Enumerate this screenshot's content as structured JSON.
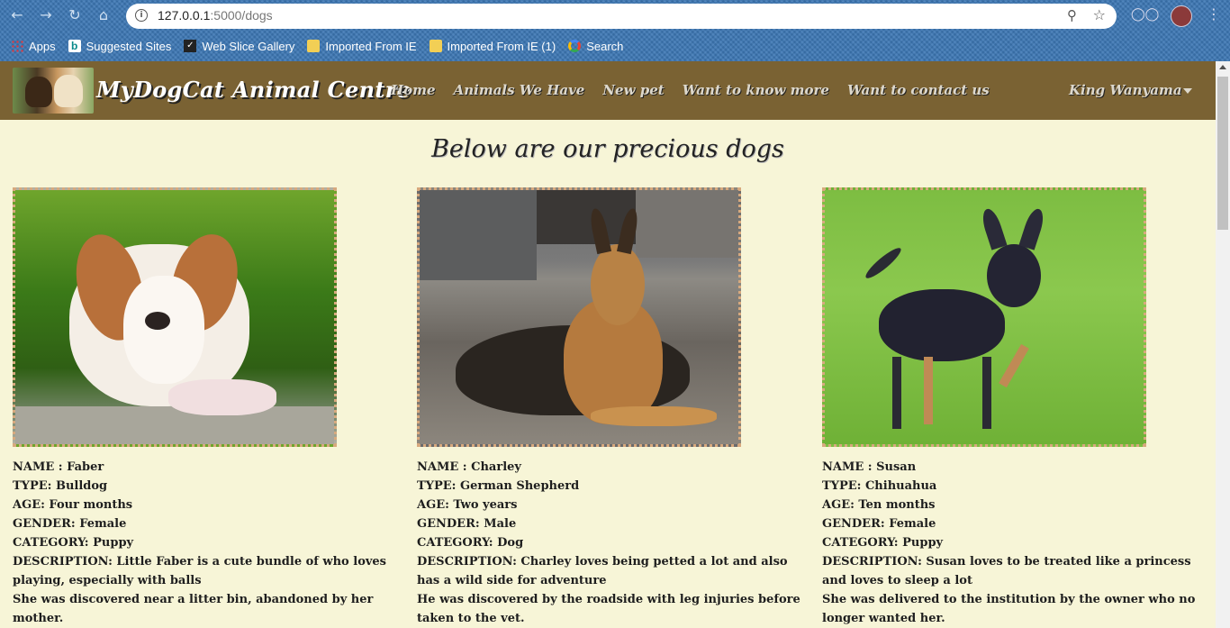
{
  "browser": {
    "url_host": "127.0.0.1",
    "url_path": ":5000/dogs",
    "bookmarks": [
      {
        "label": "Apps",
        "icon": "apps-grid-icon"
      },
      {
        "label": "Suggested Sites",
        "icon": "bing-icon"
      },
      {
        "label": "Web Slice Gallery",
        "icon": "web-slice-icon"
      },
      {
        "label": "Imported From IE",
        "icon": "folder-icon"
      },
      {
        "label": "Imported From IE (1)",
        "icon": "folder-icon"
      },
      {
        "label": "Search",
        "icon": "google-icon"
      }
    ]
  },
  "site": {
    "brand": "MyDogCat Animal Centre",
    "nav": [
      "Home",
      "Animals We Have",
      "New pet",
      "Want to know more",
      "Want to contact us"
    ],
    "user": "King Wanyama",
    "colors": {
      "navbar": "#7a6233",
      "page_bg": "#f7f5d7",
      "photo_border": "#d7a97e"
    }
  },
  "page": {
    "heading": "Below are our precious dogs",
    "dogs": [
      {
        "name": "NAME : Faber",
        "type": "TYPE: Bulldog",
        "age": "AGE: Four months",
        "gender": "GENDER: Female",
        "category": "CATEGORY: Puppy",
        "description": "DESCRIPTION: Little Faber is a cute bundle of who loves playing, especially with balls",
        "story": "She was discovered near a litter bin, abandoned by her mother."
      },
      {
        "name": "NAME : Charley",
        "type": "TYPE: German Shepherd",
        "age": "AGE: Two years",
        "gender": "GENDER: Male",
        "category": "CATEGORY: Dog",
        "description": "DESCRIPTION: Charley loves being petted a lot and also has a wild side for adventure",
        "story": "He was discovered by the roadside with leg injuries before taken to the vet."
      },
      {
        "name": "NAME : Susan",
        "type": "TYPE: Chihuahua",
        "age": "AGE: Ten months",
        "gender": "GENDER: Female",
        "category": "CATEGORY: Puppy",
        "description": "DESCRIPTION: Susan loves to be treated like a princess and loves to sleep a lot",
        "story": "She was delivered to the institution by the owner who no longer wanted her."
      }
    ]
  }
}
